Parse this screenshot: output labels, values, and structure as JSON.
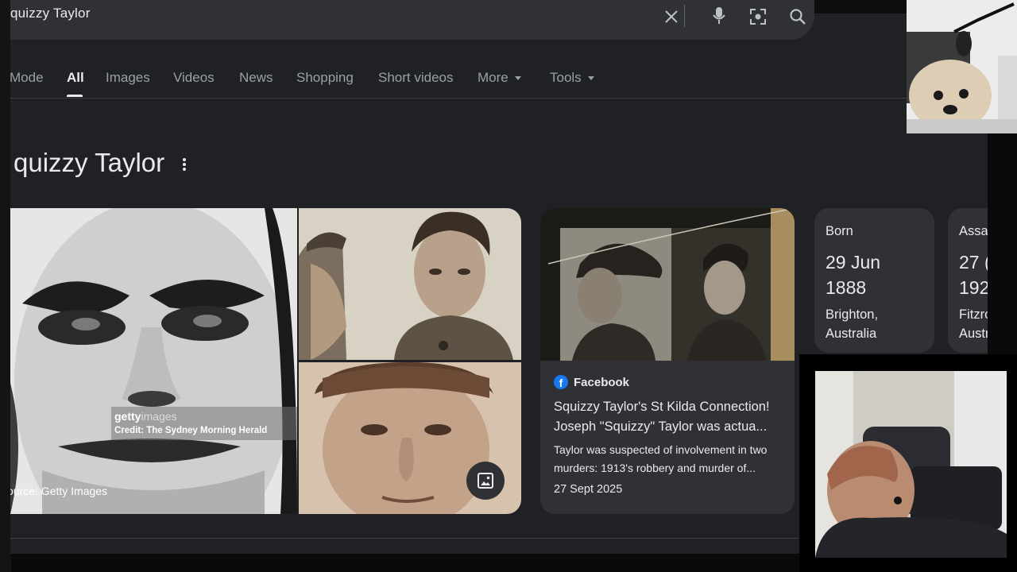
{
  "search": {
    "query": "quizzy Taylor"
  },
  "tabs": [
    {
      "label": "Mode"
    },
    {
      "label": "All"
    },
    {
      "label": "Images"
    },
    {
      "label": "Videos"
    },
    {
      "label": "News"
    },
    {
      "label": "Shopping"
    },
    {
      "label": "Short videos"
    },
    {
      "label": "More"
    },
    {
      "label": "Tools"
    }
  ],
  "panel": {
    "title": "quizzy Taylor",
    "images": {
      "getty_logo_a": "getty",
      "getty_logo_b": "images",
      "getty_credit": "Credit: The Sydney Morning Herald",
      "source": "ource: Getty Images"
    },
    "article": {
      "source": "Facebook",
      "headline_line1": "Squizzy Taylor's St Kilda Connection!",
      "headline_line2": "Joseph \"Squizzy\" Taylor was actua...",
      "snippet_line1": "Taylor was suspected of involvement in two",
      "snippet_line2": "murders: 1913's robbery and murder of...",
      "date": "27 Sept 2025"
    },
    "facts": [
      {
        "label": "Born",
        "line1": "29 Jun",
        "line2": "1888",
        "place1": "Brighton,",
        "place2": "Australia"
      },
      {
        "label": "Assa",
        "line1": "27 (",
        "line2": "192",
        "place1": "Fitzro",
        "place2": "Austr"
      }
    ]
  },
  "icons": [
    "clear-icon",
    "microphone-icon",
    "lens-icon",
    "search-icon",
    "more-vert-icon",
    "image-icon",
    "facebook-icon"
  ]
}
